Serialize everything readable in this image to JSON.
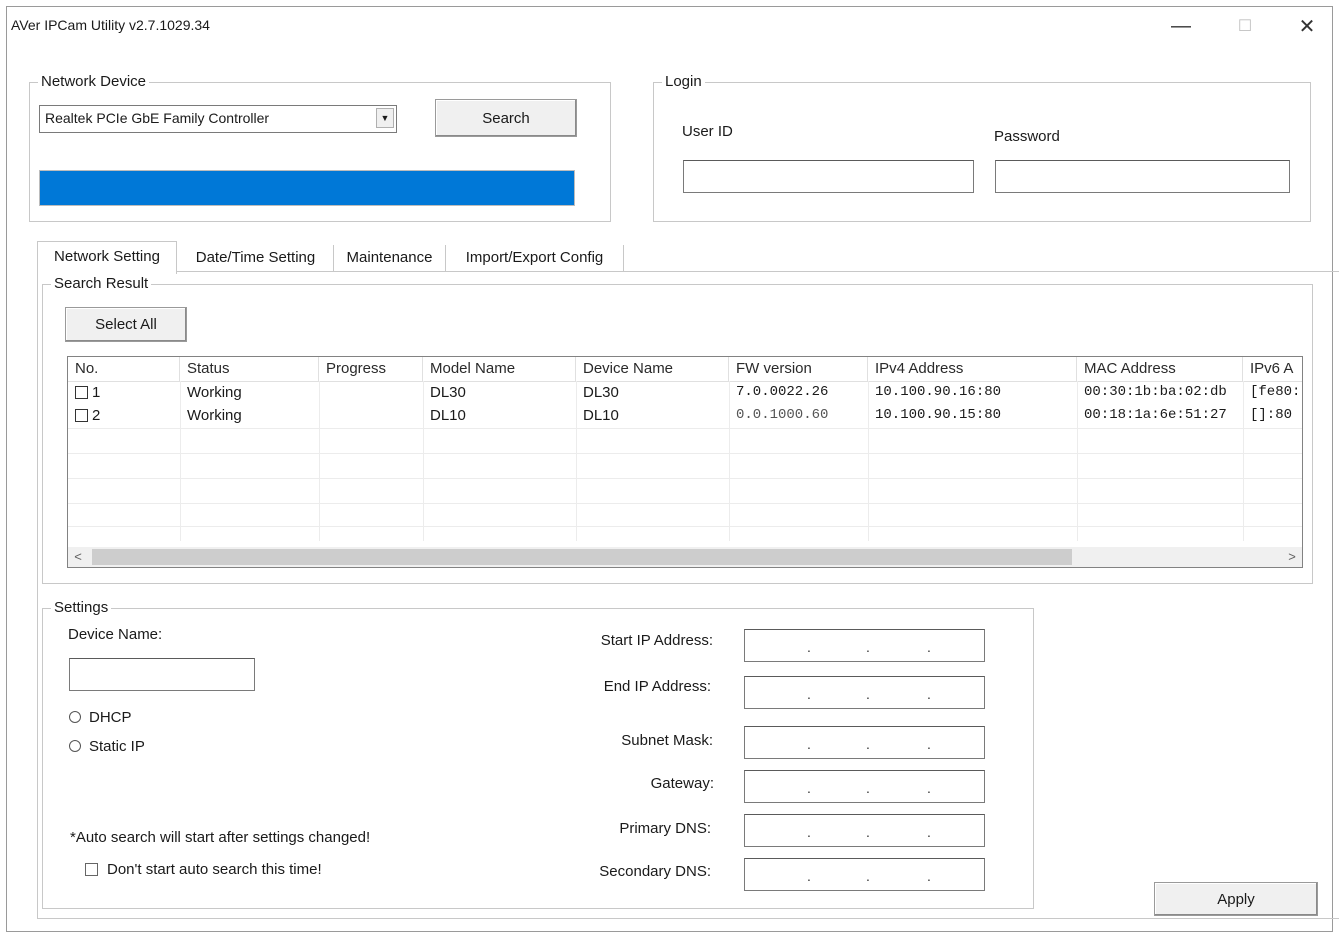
{
  "window": {
    "title": "AVer IPCam Utility v2.7.1029.34",
    "minimize_glyph": "—",
    "maximize_glyph": "☐",
    "close_glyph": "✕"
  },
  "network_device": {
    "group_label": "Network Device",
    "adapter_selected": "Realtek PCIe GbE Family Controller",
    "search_label": "Search",
    "progress_fraction": 1.0,
    "progress_color": "#0078d7"
  },
  "login": {
    "group_label": "Login",
    "user_id_label": "User ID",
    "password_label": "Password",
    "user_id_value": "",
    "password_value": ""
  },
  "tabs": [
    {
      "label": "Network Setting",
      "active": true
    },
    {
      "label": "Date/Time Setting",
      "active": false
    },
    {
      "label": "Maintenance",
      "active": false
    },
    {
      "label": "Import/Export Config",
      "active": false
    }
  ],
  "search_result": {
    "group_label": "Search Result",
    "select_all_label": "Select All",
    "columns": [
      "No.",
      "Status",
      "Progress",
      "Model Name",
      "Device Name",
      "FW version",
      "IPv4 Address",
      "MAC Address",
      "IPv6 A"
    ],
    "rows": [
      {
        "no": "1",
        "status": "Working",
        "progress": "",
        "model": "DL30",
        "device": "DL30",
        "fw": "7.0.0022.26",
        "ipv4": "10.100.90.16:80",
        "mac": "00:30:1b:ba:02:db",
        "ipv6": "[fe80:"
      },
      {
        "no": "2",
        "status": "Working",
        "progress": "",
        "model": "DL10",
        "device": "DL10",
        "fw": "0.0.1000.60",
        "ipv4": "10.100.90.15:80",
        "mac": "00:18:1a:6e:51:27",
        "ipv6": "[]:80"
      }
    ],
    "scroll_left_glyph": "<",
    "scroll_right_glyph": ">"
  },
  "settings": {
    "group_label": "Settings",
    "device_name_label": "Device Name:",
    "device_name_value": "",
    "dhcp_label": "DHCP",
    "static_ip_label": "Static IP",
    "auto_search_note": "*Auto search will start after settings changed!",
    "dont_auto_search_label": "Don't start auto search this time!",
    "start_ip_label": "Start IP Address:",
    "end_ip_label": "End IP Address:",
    "subnet_mask_label": "Subnet Mask:",
    "gateway_label": "Gateway:",
    "primary_dns_label": "Primary DNS:",
    "secondary_dns_label": "Secondary DNS:",
    "ip_dot": "."
  },
  "apply_label": "Apply"
}
